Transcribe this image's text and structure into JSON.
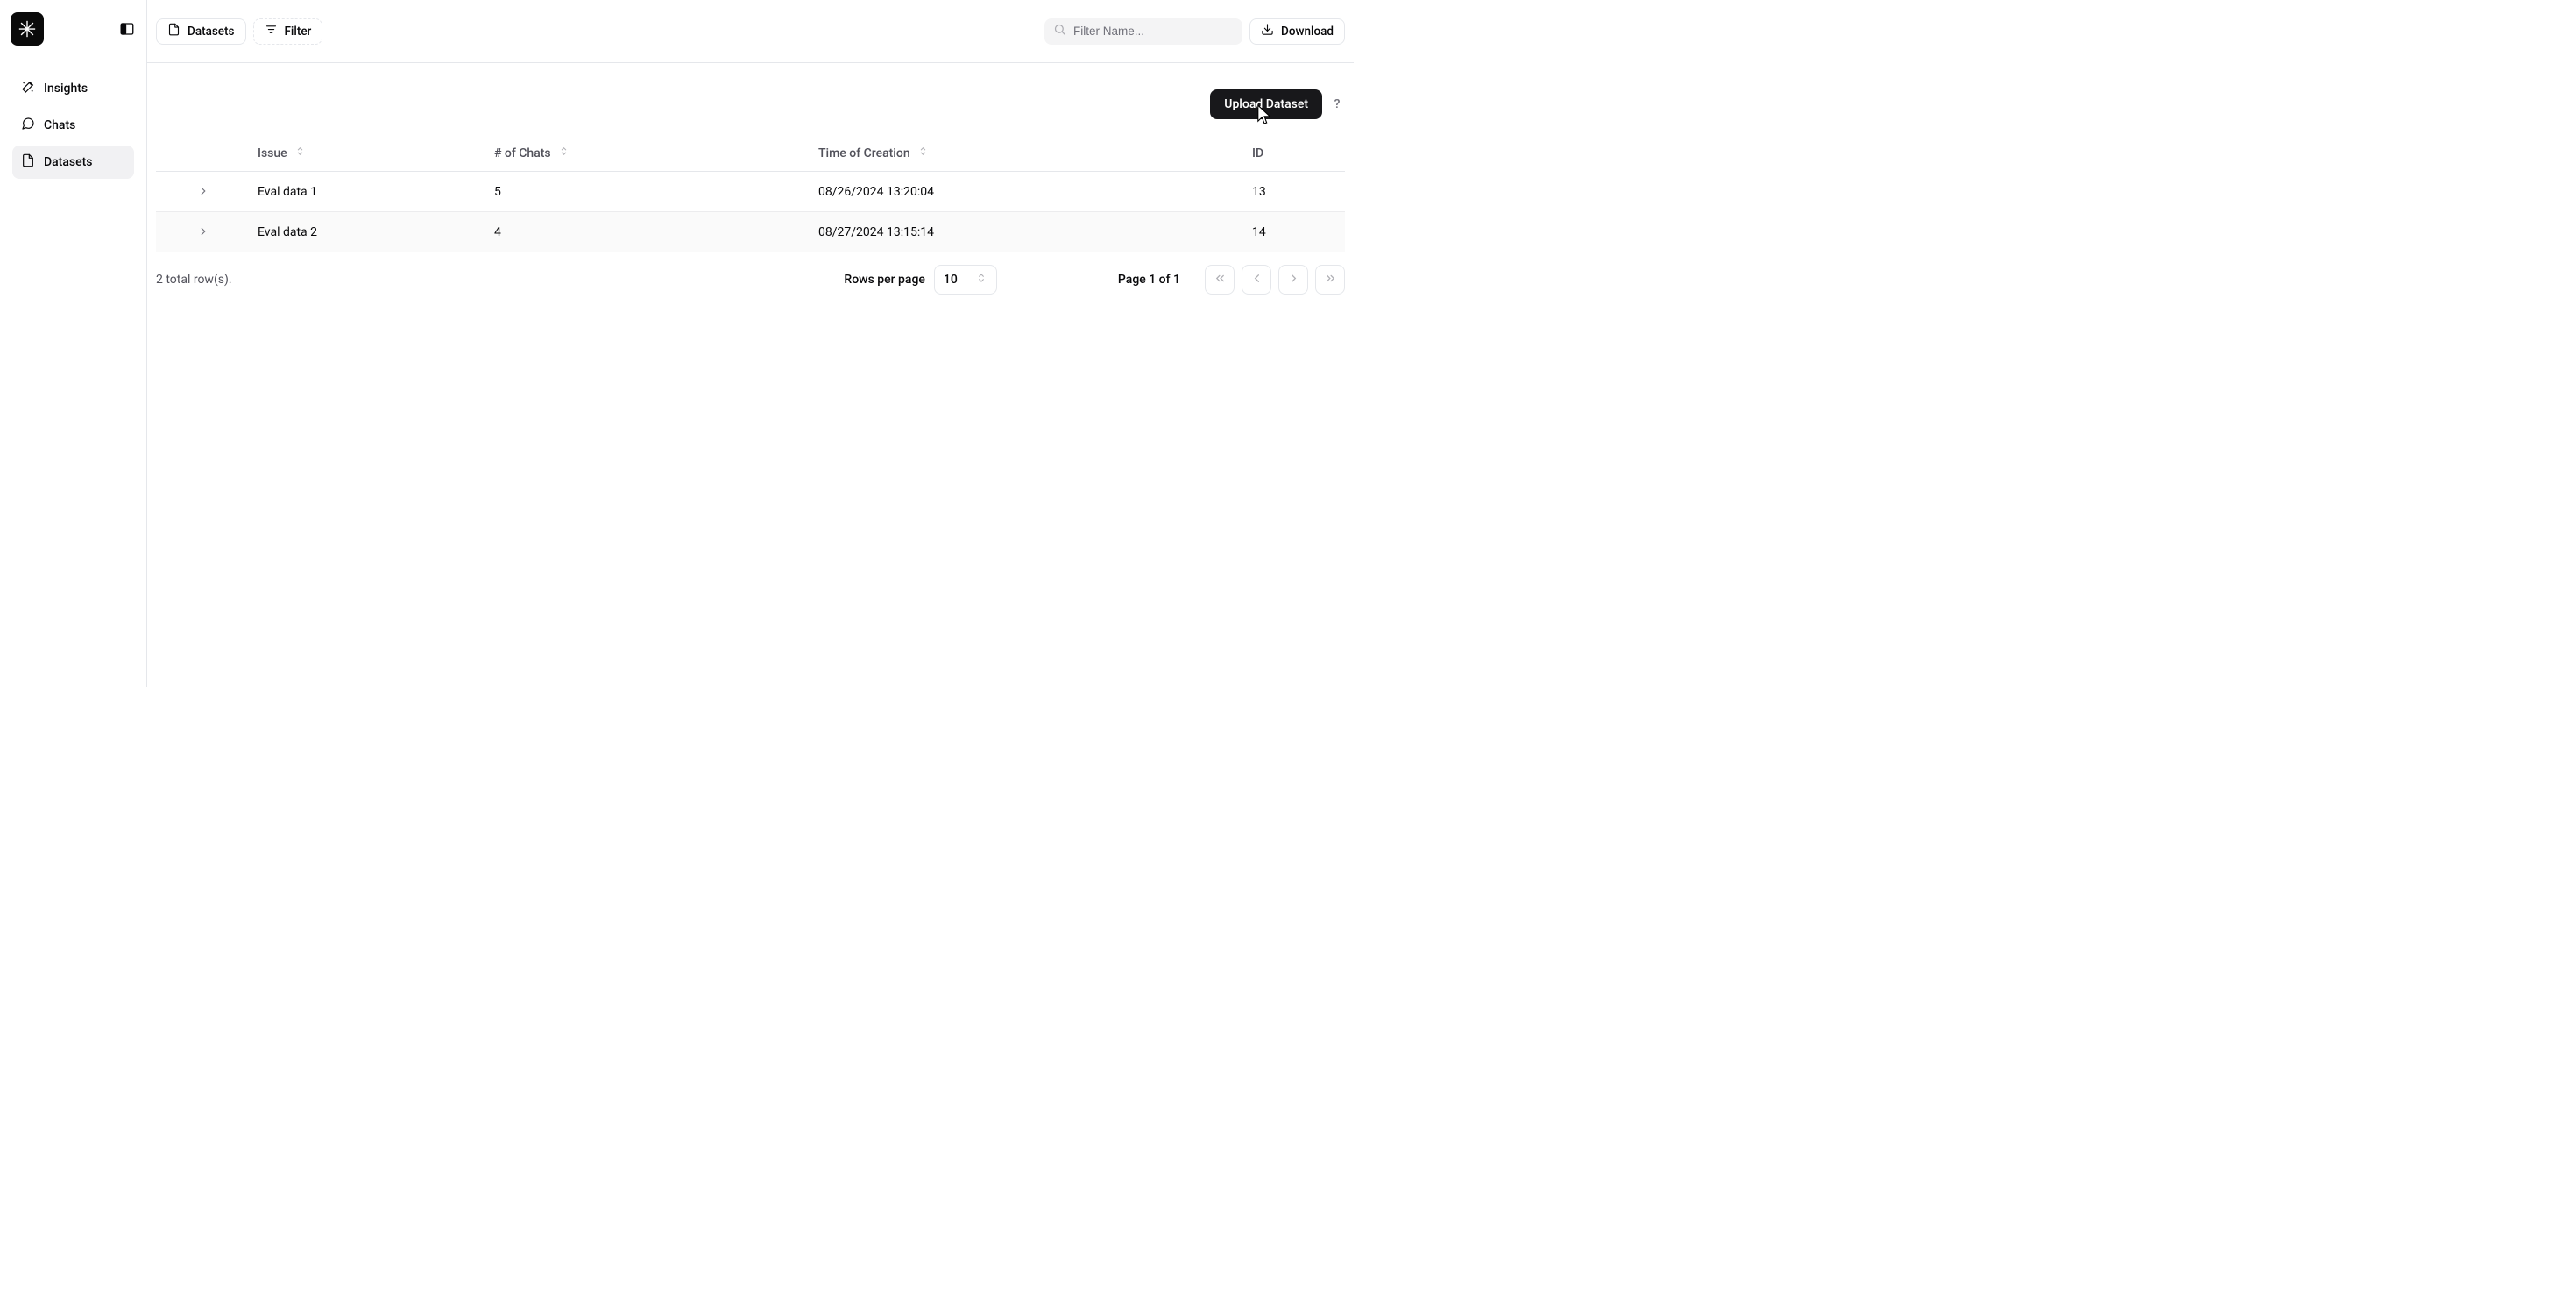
{
  "sidebar": {
    "items": [
      {
        "label": "Insights"
      },
      {
        "label": "Chats"
      },
      {
        "label": "Datasets"
      }
    ]
  },
  "toolbar": {
    "breadcrumb_label": "Datasets",
    "filter_label": "Filter",
    "download_label": "Download",
    "search_placeholder": "Filter Name..."
  },
  "header": {
    "upload_label": "Upload Dataset",
    "help_label": "?"
  },
  "table": {
    "columns": {
      "issue": "Issue",
      "chats": "# of Chats",
      "time": "Time of Creation",
      "id": "ID"
    },
    "rows": [
      {
        "issue": "Eval data 1",
        "chats": "5",
        "time": "08/26/2024 13:20:04",
        "id": "13"
      },
      {
        "issue": "Eval data 2",
        "chats": "4",
        "time": "08/27/2024 13:15:14",
        "id": "14"
      }
    ]
  },
  "pager": {
    "summary": "2 total row(s).",
    "rpp_label": "Rows per page",
    "rpp_value": "10",
    "page_label": "Page 1 of 1"
  }
}
